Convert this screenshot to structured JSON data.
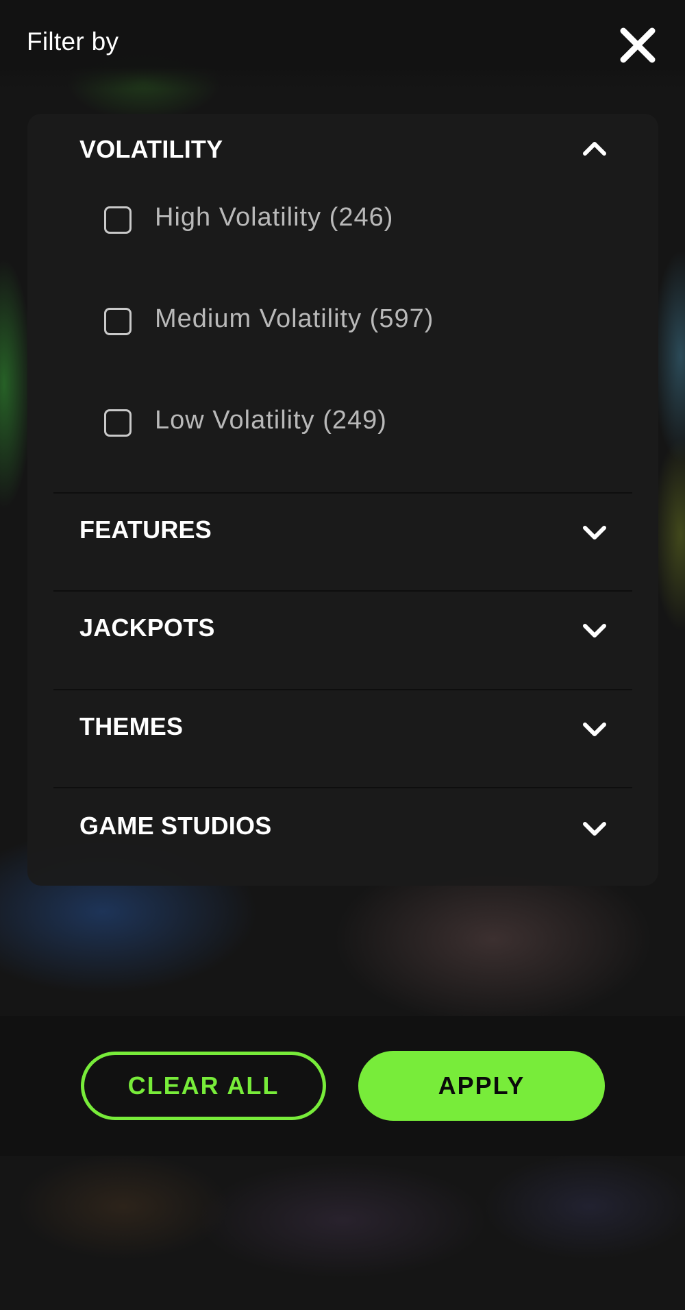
{
  "header": {
    "title": "Filter by",
    "close_icon": "close-icon"
  },
  "sections": [
    {
      "title": "VOLATILITY",
      "expanded": true,
      "icon": "chevron-up-icon",
      "options": [
        {
          "label": "High Volatility (246)",
          "checked": false
        },
        {
          "label": "Medium Volatility (597)",
          "checked": false
        },
        {
          "label": "Low Volatility (249)",
          "checked": false
        }
      ]
    },
    {
      "title": "FEATURES",
      "expanded": false,
      "icon": "chevron-down-icon"
    },
    {
      "title": "JACKPOTS",
      "expanded": false,
      "icon": "chevron-down-icon"
    },
    {
      "title": "THEMES",
      "expanded": false,
      "icon": "chevron-down-icon"
    },
    {
      "title": "GAME STUDIOS",
      "expanded": false,
      "icon": "chevron-down-icon"
    }
  ],
  "footer": {
    "clear_label": "CLEAR ALL",
    "apply_label": "APPLY"
  },
  "colors": {
    "accent": "#78ec3a",
    "panel": "#1b1b1b",
    "text": "#ffffff",
    "option_text": "#b9b9b9"
  }
}
